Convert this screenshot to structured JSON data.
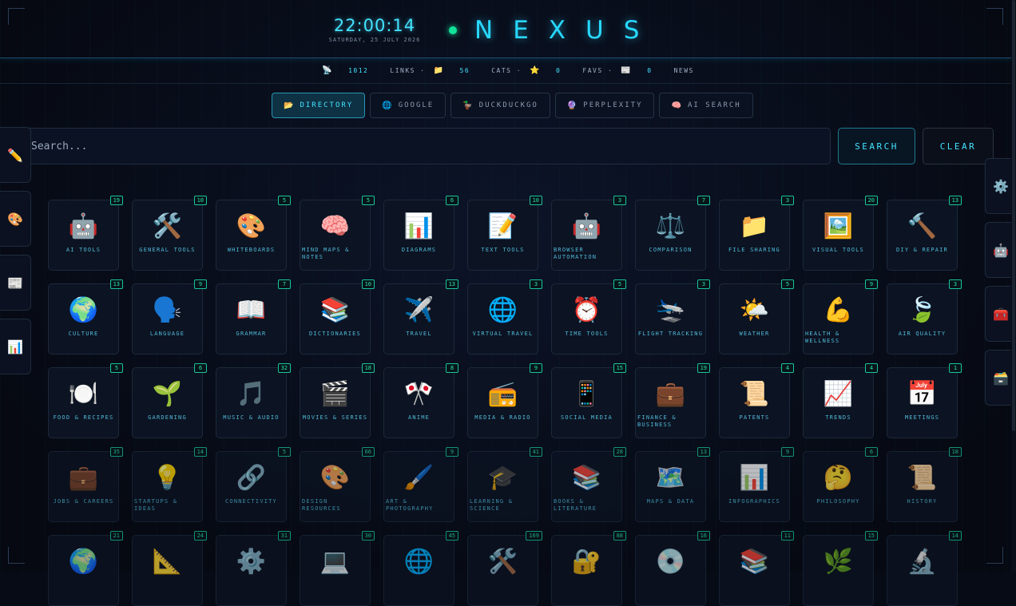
{
  "header": {
    "time": "22:00:14",
    "date": "SATURDAY, 25 JULY 2026",
    "brand": "NEXUS"
  },
  "stats": {
    "links_icon": "📡",
    "links_count": "1012",
    "links_label": "LINKS ·",
    "cats_icon": "📁",
    "cats_count": "56",
    "cats_label": "CATS ·",
    "favs_icon": "⭐",
    "favs_count": "0",
    "favs_label": "FAVS ·",
    "news_icon": "📰",
    "news_count": "0",
    "news_label": "NEWS"
  },
  "tabs": [
    {
      "icon": "📂",
      "label": "DIRECTORY",
      "active": true
    },
    {
      "icon": "🌐",
      "label": "GOOGLE"
    },
    {
      "icon": "🦆",
      "label": "DUCKDUCKGO"
    },
    {
      "icon": "🔮",
      "label": "PERPLEXITY"
    },
    {
      "icon": "🧠",
      "label": "AI SEARCH"
    }
  ],
  "search": {
    "placeholder": "Search...",
    "search_label": "SEARCH",
    "clear_label": "CLEAR"
  },
  "sidebar_left": [
    "✏️",
    "🎨",
    "📰",
    "📊"
  ],
  "sidebar_right": [
    "⚙️",
    "🤖",
    "🧰",
    "🗃️"
  ],
  "categories": [
    {
      "icon": "🤖",
      "label": "AI TOOLS",
      "count": "19"
    },
    {
      "icon": "🛠️",
      "label": "GENERAL TOOLS",
      "count": "10"
    },
    {
      "icon": "🎨",
      "label": "WHITEBOARDS",
      "count": "5"
    },
    {
      "icon": "🧠",
      "label": "MIND MAPS & NOTES",
      "count": "5"
    },
    {
      "icon": "📊",
      "label": "DIAGRAMS",
      "count": "6"
    },
    {
      "icon": "📝",
      "label": "TEXT TOOLS",
      "count": "10"
    },
    {
      "icon": "🤖",
      "label": "BROWSER AUTOMATION",
      "count": "3"
    },
    {
      "icon": "⚖️",
      "label": "COMPARISON",
      "count": "7"
    },
    {
      "icon": "📁",
      "label": "FILE SHARING",
      "count": "3"
    },
    {
      "icon": "🖼️",
      "label": "VISUAL TOOLS",
      "count": "20"
    },
    {
      "icon": "🔨",
      "label": "DIY & REPAIR",
      "count": "13"
    },
    {
      "icon": "🌍",
      "label": "CULTURE",
      "count": "13"
    },
    {
      "icon": "🗣️",
      "label": "LANGUAGE",
      "count": "9"
    },
    {
      "icon": "📖",
      "label": "GRAMMAR",
      "count": "7"
    },
    {
      "icon": "📚",
      "label": "DICTIONARIES",
      "count": "10"
    },
    {
      "icon": "✈️",
      "label": "TRAVEL",
      "count": "13"
    },
    {
      "icon": "🌐",
      "label": "VIRTUAL TRAVEL",
      "count": "3"
    },
    {
      "icon": "⏰",
      "label": "TIME TOOLS",
      "count": "5"
    },
    {
      "icon": "🛬",
      "label": "FLIGHT TRACKING",
      "count": "3"
    },
    {
      "icon": "🌤️",
      "label": "WEATHER",
      "count": "5"
    },
    {
      "icon": "💪",
      "label": "HEALTH & WELLNESS",
      "count": "9"
    },
    {
      "icon": "🍃",
      "label": "AIR QUALITY",
      "count": "3"
    },
    {
      "icon": "🍽️",
      "label": "FOOD & RECIPES",
      "count": "5"
    },
    {
      "icon": "🌱",
      "label": "GARDENING",
      "count": "6"
    },
    {
      "icon": "🎵",
      "label": "MUSIC & AUDIO",
      "count": "32"
    },
    {
      "icon": "🎬",
      "label": "MOVIES & SERIES",
      "count": "18"
    },
    {
      "icon": "🎌",
      "label": "ANIME",
      "count": "8"
    },
    {
      "icon": "📻",
      "label": "MEDIA & RADIO",
      "count": "9"
    },
    {
      "icon": "📱",
      "label": "SOCIAL MEDIA",
      "count": "15"
    },
    {
      "icon": "💼",
      "label": "FINANCE & BUSINESS",
      "count": "19"
    },
    {
      "icon": "📜",
      "label": "PATENTS",
      "count": "4"
    },
    {
      "icon": "📈",
      "label": "TRENDS",
      "count": "4"
    },
    {
      "icon": "📅",
      "label": "MEETINGS",
      "count": "1"
    },
    {
      "icon": "💼",
      "label": "JOBS & CAREERS",
      "count": "35"
    },
    {
      "icon": "💡",
      "label": "STARTUPS & IDEAS",
      "count": "14"
    },
    {
      "icon": "🔗",
      "label": "CONNECTIVITY",
      "count": "5"
    },
    {
      "icon": "🎨",
      "label": "DESIGN RESOURCES",
      "count": "66"
    },
    {
      "icon": "🖌️",
      "label": "ART & PHOTOGRAPHY",
      "count": "9"
    },
    {
      "icon": "🎓",
      "label": "LEARNING & SCIENCE",
      "count": "41"
    },
    {
      "icon": "📚",
      "label": "BOOKS & LITERATURE",
      "count": "28"
    },
    {
      "icon": "🗺️",
      "label": "MAPS & DATA",
      "count": "13"
    },
    {
      "icon": "📊",
      "label": "INFOGRAPHICS",
      "count": "9"
    },
    {
      "icon": "🤔",
      "label": "PHILOSOPHY",
      "count": "6"
    },
    {
      "icon": "📜",
      "label": "HISTORY",
      "count": "18"
    },
    {
      "icon": "🌍",
      "label": "",
      "count": "21"
    },
    {
      "icon": "📐",
      "label": "",
      "count": "24"
    },
    {
      "icon": "⚙️",
      "label": "",
      "count": "31"
    },
    {
      "icon": "💻",
      "label": "",
      "count": "30"
    },
    {
      "icon": "🌐",
      "label": "",
      "count": "45"
    },
    {
      "icon": "🛠️",
      "label": "",
      "count": "169"
    },
    {
      "icon": "🔐",
      "label": "",
      "count": "88"
    },
    {
      "icon": "💿",
      "label": "",
      "count": "16"
    },
    {
      "icon": "📚",
      "label": "",
      "count": "11"
    },
    {
      "icon": "🌿",
      "label": "",
      "count": "15"
    },
    {
      "icon": "🔬",
      "label": "",
      "count": "14"
    }
  ]
}
